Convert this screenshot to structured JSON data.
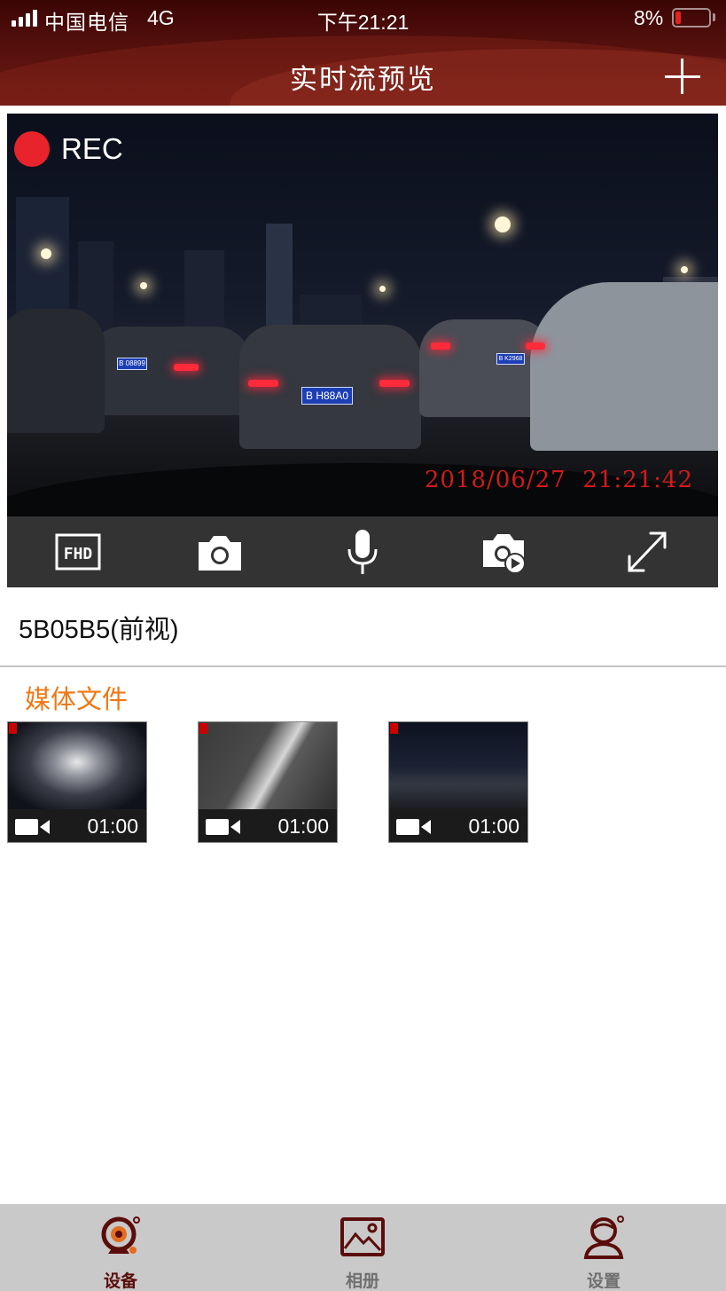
{
  "status_bar": {
    "carrier": "中国电信",
    "network": "4G",
    "time": "下午21:21",
    "battery_percent": "8%",
    "battery_level": 0.08
  },
  "header": {
    "title": "实时流预览",
    "add_icon": "plus-icon"
  },
  "live_view": {
    "rec_label": "REC",
    "osd_timestamp": "2018/06/27  21:21:42",
    "plates": [
      "B 08899",
      "B H88A0",
      "B K2968"
    ]
  },
  "controls": [
    {
      "name": "resolution-fhd",
      "icon": "fhd-icon",
      "label": "FHD"
    },
    {
      "name": "snapshot",
      "icon": "camera-icon"
    },
    {
      "name": "microphone",
      "icon": "microphone-icon"
    },
    {
      "name": "snapshot-playback",
      "icon": "camera-play-icon"
    },
    {
      "name": "fullscreen",
      "icon": "expand-icon"
    }
  ],
  "device": {
    "name": "5B05B5(前视)"
  },
  "media": {
    "title": "媒体文件",
    "items": [
      {
        "duration": "01:00",
        "icon": "video-camera-icon"
      },
      {
        "duration": "01:00",
        "icon": "video-camera-icon"
      },
      {
        "duration": "01:00",
        "icon": "video-camera-icon"
      }
    ]
  },
  "tabbar": {
    "active_color": "#5a0d0a",
    "inactive_color": "#6f6f6f",
    "items": [
      {
        "label": "设备",
        "icon": "dashcam-icon",
        "active": true
      },
      {
        "label": "相册",
        "icon": "picture-icon",
        "active": false
      },
      {
        "label": "设置",
        "icon": "user-settings-icon",
        "active": false
      }
    ]
  }
}
